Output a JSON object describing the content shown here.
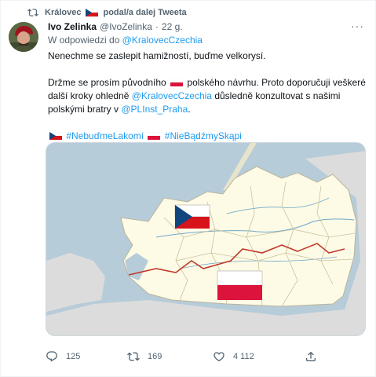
{
  "retweet": {
    "user": "Královec",
    "suffix": "podal/a dalej Tweeta"
  },
  "tweet": {
    "author_name": "Ivo Zelinka",
    "author_handle": "@IvoZelinka",
    "separator": "·",
    "time": "22 g.",
    "reply_prefix": "W odpowiedzi do",
    "reply_handle": "@KralovecCzechia",
    "paragraph1": "Nenechme se zaslepit hamižností, buďme velkorysí.",
    "p2_part1": "Držme se prosím původního",
    "p2_part2": "polského návrhu. Proto doporučuji veškeré další kroky ohledně",
    "p2_mention1": "@KralovecCzechia",
    "p2_part3": "důsledně konzultovat s našimi polskými bratry v",
    "p2_mention2": "@PLInst_Praha",
    "p2_end": ".",
    "hashtag1": "#NebuďmeLakomí",
    "hashtag2": "#NieBądźmySkąpi",
    "more_label": "···"
  },
  "actions": {
    "replies": "125",
    "retweets": "169",
    "likes": "4 112"
  },
  "colors": {
    "link": "#1d9bf0",
    "secondary_text": "#536471",
    "sea": "#b7ccd9",
    "land": "#fdfbe6",
    "outside_land": "#dcdcdc",
    "border_red": "#c0392b"
  },
  "icons": {
    "retweet": "retweet-icon",
    "reply": "reply-icon",
    "like": "heart-icon",
    "share": "share-icon",
    "more": "more-icon"
  }
}
